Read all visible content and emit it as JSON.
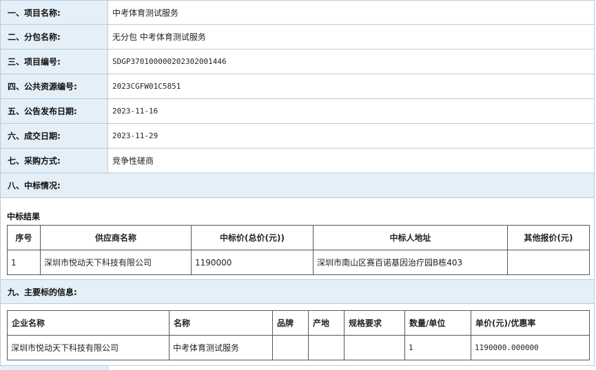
{
  "info_rows": [
    {
      "label": "一、项目名称:",
      "value": "中考体育测试服务"
    },
    {
      "label": "二、分包名称:",
      "value": "无分包 中考体育测试服务"
    },
    {
      "label": "三、项目编号:",
      "value": "SDGP370100000202302001446"
    },
    {
      "label": "四、公共资源编号:",
      "value": "2023CGFW01C5851"
    },
    {
      "label": "五、公告发布日期:",
      "value": "2023-11-16"
    },
    {
      "label": "六、成交日期:",
      "value": "2023-11-29"
    },
    {
      "label": "七、采购方式:",
      "value": "竞争性磋商"
    }
  ],
  "section8": {
    "label": "八、中标情况:"
  },
  "result": {
    "title": "中标结果",
    "headers": [
      "序号",
      "供应商名称",
      "中标价(总价(元))",
      "中标人地址",
      "其他报价(元)"
    ],
    "rows": [
      [
        "1",
        "深圳市悦动天下科技有限公司",
        "1190000",
        "深圳市南山区赛百诺基因治疗园B栋403",
        ""
      ]
    ]
  },
  "section9": {
    "label": "九、主要标的信息:"
  },
  "items": {
    "headers": [
      "企业名称",
      "名称",
      "品牌",
      "产地",
      "规格要求",
      "数量/单位",
      "单价(元)/优惠率"
    ],
    "rows": [
      [
        "深圳市悦动天下科技有限公司",
        "中考体育测试服务",
        "",
        "",
        "",
        "1",
        "1190000.000000"
      ]
    ]
  }
}
